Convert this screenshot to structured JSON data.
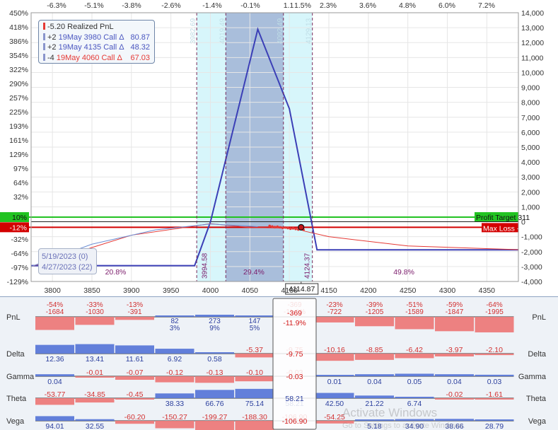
{
  "chart_data": {
    "type": "line",
    "x_ticks": [
      "3800",
      "3850",
      "3900",
      "3950",
      "4000",
      "4050",
      "4100",
      "4150",
      "4200",
      "4250",
      "4300",
      "4350"
    ],
    "xlim": [
      3773,
      4390
    ],
    "top_pct_ticks": [
      "-6.3%",
      "-5.1%",
      "-3.8%",
      "-2.6%",
      "-1.4%",
      "-0.1%",
      "1.1",
      "1.5%",
      "2.3%",
      "3.6%",
      "4.8%",
      "6.0%",
      "7.2%"
    ],
    "left_pct_ticks": [
      "450%",
      "418%",
      "386%",
      "354%",
      "322%",
      "290%",
      "257%",
      "225%",
      "193%",
      "161%",
      "129%",
      "97%",
      "64%",
      "32%",
      "10%",
      "-12%",
      "-32%",
      "-64%",
      "-97%",
      "-129%"
    ],
    "right_ticks": [
      "14,000",
      "13,000",
      "12,000",
      "11,000",
      "10,000",
      "9,000",
      "8,000",
      "7,000",
      "6,000",
      "5,000",
      "4,000",
      "3,000",
      "2,000",
      "1,000",
      "0",
      "-1,000",
      "-2,000",
      "-3,000",
      "-4,000"
    ],
    "ylim": [
      -4000,
      14000
    ],
    "expiration_pnl": {
      "x": [
        3773,
        3980,
        4000,
        4060,
        4100,
        4135,
        4390
      ],
      "y": [
        -2940,
        -2940,
        -20,
        12890,
        7570,
        -1880,
        -1880
      ]
    },
    "current_pnl": {
      "x": [
        3773,
        3900,
        4000,
        4050,
        4090,
        4110,
        4120,
        4150,
        4250,
        4390
      ],
      "y": [
        -3000,
        -900,
        -130,
        -380,
        -420,
        -460,
        -640,
        -1000,
        -1620,
        -1870
      ]
    },
    "profit_target": {
      "label": "Profit Target 311",
      "value": 311,
      "pct_label": "10%"
    },
    "max_loss": {
      "label": "Max Loss -369",
      "value": -369,
      "pct_label": "-12%"
    },
    "breakevens": [
      {
        "label": "3982.69",
        "x": 3982.69
      },
      {
        "label": "4019.49",
        "x": 4019.49
      },
      {
        "label": "4092.49",
        "x": 4092.49
      },
      {
        "label": "4129.13",
        "x": 4129.13
      }
    ],
    "breakeven_lower_labels": [
      {
        "label": "3994.58",
        "x": 3994.58
      },
      {
        "label": "4124.37",
        "x": 4124.37
      }
    ],
    "shade_outer": [
      3982.69,
      4129.13
    ],
    "shade_inner": [
      4019.49,
      4092.49
    ],
    "zone_labels": [
      {
        "label": "20.8%",
        "x": 3880
      },
      {
        "label": "29.4%",
        "x": 4055
      },
      {
        "label": "49.8%",
        "x": 4245
      }
    ],
    "current_price": {
      "label": "4114.87",
      "x": 4114.87,
      "y": -369
    },
    "colors": {
      "expiration": "#3b3fb6",
      "current": "#e53935",
      "profit": "#22c322",
      "loss": "#d30000",
      "shade_outer": "#d7f6fb",
      "shade_inner": "#a9bedb"
    }
  },
  "legend": {
    "items": [
      {
        "prefix": "",
        "text": "-5.20 Realized PnL",
        "value": "",
        "color": "#e53935"
      },
      {
        "prefix": "+2",
        "text": "19May 3980 Call Δ",
        "value": "80.87",
        "color": "#5566cc"
      },
      {
        "prefix": "+2",
        "text": "19May 4135 Call Δ",
        "value": "48.32",
        "color": "#5566cc"
      },
      {
        "prefix": "-4",
        "text": "19May 4060 Call Δ",
        "value": "67.03",
        "color": "#e53935"
      }
    ]
  },
  "dates": {
    "expiry": "5/19/2023 (0)",
    "current": "4/27/2023 (22)"
  },
  "greeks": {
    "rows": [
      {
        "name": "PnL",
        "cells": [
          {
            "t": "-54%",
            "b": "-1684",
            "v": -1684
          },
          {
            "t": "-33%",
            "b": "-1030",
            "v": -1030
          },
          {
            "t": "-13%",
            "b": "-391",
            "v": -391
          },
          {
            "t": "82",
            "b": "3%",
            "v": 82
          },
          {
            "t": "273",
            "b": "9%",
            "v": 273
          },
          {
            "t": "147",
            "b": "5%",
            "v": 147
          },
          {
            "t": "-369",
            "b": "-11.9%",
            "v": -369,
            "current": true
          },
          {
            "t": "-23%",
            "b": "-722",
            "v": -722
          },
          {
            "t": "-39%",
            "b": "-1205",
            "v": -1205
          },
          {
            "t": "-51%",
            "b": "-1589",
            "v": -1589
          },
          {
            "t": "-59%",
            "b": "-1847",
            "v": -1847
          },
          {
            "t": "-64%",
            "b": "-1995",
            "v": -1995
          }
        ],
        "max": 2000
      },
      {
        "name": "Delta",
        "cells": [
          {
            "t": "12.36",
            "v": 12.36
          },
          {
            "t": "13.41",
            "v": 13.41
          },
          {
            "t": "11.61",
            "v": 11.61
          },
          {
            "t": "6.92",
            "v": 6.92
          },
          {
            "t": "0.58",
            "v": 0.58
          },
          {
            "t": "-5.37",
            "v": -5.37
          },
          {
            "t": "-9.75",
            "v": -9.75,
            "current": true
          },
          {
            "t": "-10.16",
            "v": -10.16
          },
          {
            "t": "-8.85",
            "v": -8.85
          },
          {
            "t": "-6.42",
            "v": -6.42
          },
          {
            "t": "-3.97",
            "v": -3.97
          },
          {
            "t": "-2.10",
            "v": -2.1
          }
        ],
        "max": 14
      },
      {
        "name": "Gamma",
        "cells": [
          {
            "t": "0.04",
            "v": 0.04
          },
          {
            "t": "-0.01",
            "v": -0.01
          },
          {
            "t": "-0.07",
            "v": -0.07
          },
          {
            "t": "-0.12",
            "v": -0.12
          },
          {
            "t": "-0.13",
            "v": -0.13
          },
          {
            "t": "-0.10",
            "v": -0.1
          },
          {
            "t": "-0.03",
            "v": -0.03,
            "current": true
          },
          {
            "t": "0.01",
            "v": 0.01
          },
          {
            "t": "0.04",
            "v": 0.04
          },
          {
            "t": "0.05",
            "v": 0.05
          },
          {
            "t": "0.04",
            "v": 0.04
          },
          {
            "t": "0.03",
            "v": 0.03
          }
        ],
        "max": 0.14
      },
      {
        "name": "Theta",
        "cells": [
          {
            "t": "-53.77",
            "v": -53.77
          },
          {
            "t": "-34.85",
            "v": -34.85
          },
          {
            "t": "-0.45",
            "v": -0.45
          },
          {
            "t": "38.33",
            "v": 38.33
          },
          {
            "t": "66.76",
            "v": 66.76
          },
          {
            "t": "75.14",
            "v": 75.14
          },
          {
            "t": "58.21",
            "v": 58.21,
            "current": true
          },
          {
            "t": "42.50",
            "v": 42.5
          },
          {
            "t": "21.22",
            "v": 21.22
          },
          {
            "t": "6.74",
            "v": 6.74
          },
          {
            "t": "-0.02",
            "v": -0.02
          },
          {
            "t": "-1.61",
            "v": -1.61
          }
        ],
        "max": 80
      },
      {
        "name": "Vega",
        "cells": [
          {
            "t": "94.01",
            "v": 94.01
          },
          {
            "t": "32.55",
            "v": 32.55
          },
          {
            "t": "-60.20",
            "v": -60.2
          },
          {
            "t": "-150.27",
            "v": -150.27
          },
          {
            "t": "-199.27",
            "v": -199.27
          },
          {
            "t": "-188.30",
            "v": -188.3
          },
          {
            "t": "-106.90",
            "v": -106.9,
            "current": true
          },
          {
            "t": "-54.25",
            "v": -54.25
          },
          {
            "t": "5.18",
            "v": 5.18
          },
          {
            "t": "34.90",
            "v": 34.9
          },
          {
            "t": "38.66",
            "v": 38.66
          },
          {
            "t": "28.79",
            "v": 28.79
          }
        ],
        "max": 200
      }
    ]
  },
  "watermark": {
    "title": "Activate Windows",
    "subtitle": "Go to Settings to activate Windows."
  }
}
